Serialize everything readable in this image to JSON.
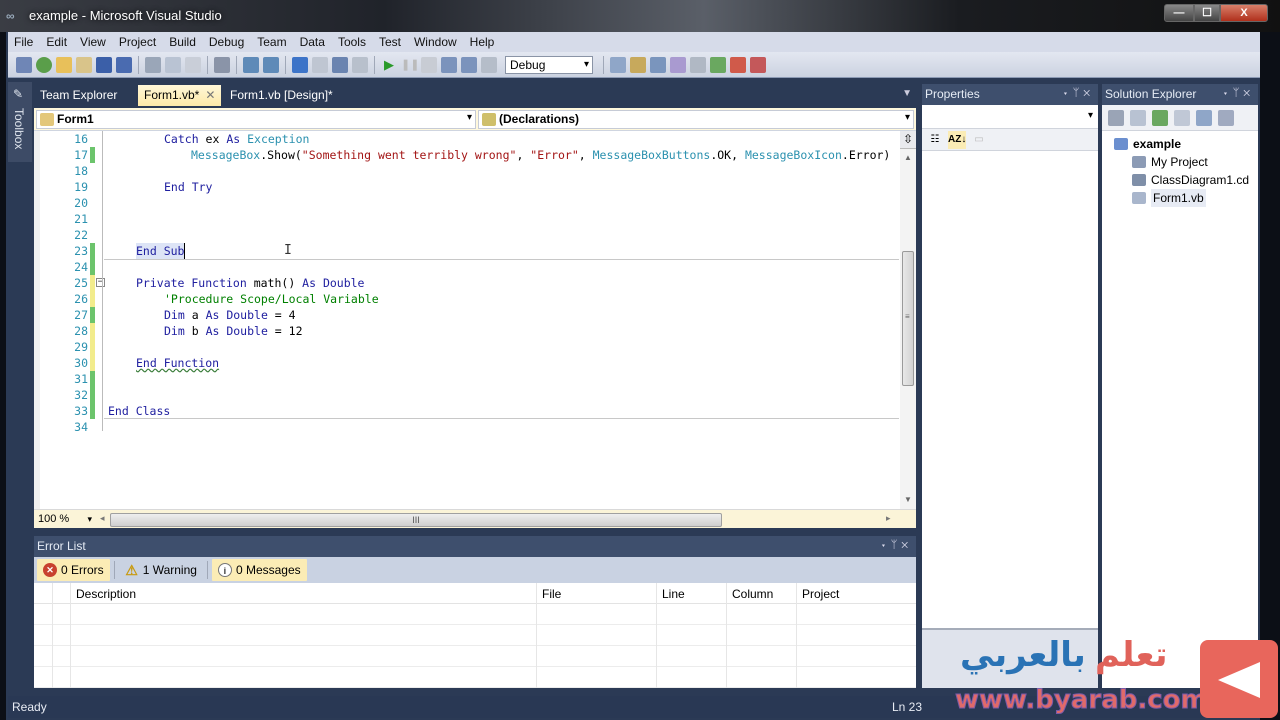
{
  "window": {
    "title": "example - Microsoft Visual Studio",
    "controls": {
      "minimize": "—",
      "maximize": "☐",
      "close": "X"
    }
  },
  "menu": [
    "File",
    "Edit",
    "View",
    "Project",
    "Build",
    "Debug",
    "Team",
    "Data",
    "Tools",
    "Test",
    "Window",
    "Help"
  ],
  "toolbar": {
    "config_value": "Debug",
    "icons": [
      "new-project-icon",
      "add-item-icon",
      "open-file-icon",
      "add-new-item-icon",
      "save-icon",
      "save-all-icon",
      "cut-icon",
      "copy-icon",
      "paste-icon",
      "find-icon",
      "comment-icon",
      "uncomment-icon",
      "undo-icon",
      "redo-icon",
      "navigate-back-icon",
      "navigate-forward-icon",
      "start-debug-icon",
      "pause-icon",
      "stop-icon",
      "step-into-icon",
      "step-over-icon",
      "step-out-icon",
      "solution-explorer-icon",
      "properties-icon",
      "object-browser-icon",
      "toolbox-icon",
      "tools-icon",
      "extension-icon",
      "error-icon",
      "window-icon"
    ]
  },
  "toolbox": {
    "label": "Toolbox"
  },
  "doc_tabs": [
    {
      "label": "Team Explorer",
      "active": false
    },
    {
      "label": "Form1.vb*",
      "active": true
    },
    {
      "label": "Form1.vb [Design]*",
      "active": false
    }
  ],
  "navbar": {
    "class_combo": "Form1",
    "member_combo": "(Declarations)"
  },
  "editor": {
    "lines": [
      {
        "n": "16",
        "change": ""
      },
      {
        "n": "17",
        "change": "green"
      },
      {
        "n": "18",
        "change": ""
      },
      {
        "n": "19",
        "change": ""
      },
      {
        "n": "20",
        "change": ""
      },
      {
        "n": "21",
        "change": ""
      },
      {
        "n": "22",
        "change": ""
      },
      {
        "n": "23",
        "change": "green"
      },
      {
        "n": "24",
        "change": "green"
      },
      {
        "n": "25",
        "change": "yellow"
      },
      {
        "n": "26",
        "change": "yellow"
      },
      {
        "n": "27",
        "change": "green"
      },
      {
        "n": "28",
        "change": "yellow"
      },
      {
        "n": "29",
        "change": "yellow"
      },
      {
        "n": "30",
        "change": "yellow"
      },
      {
        "n": "31",
        "change": "green"
      },
      {
        "n": "32",
        "change": "green"
      },
      {
        "n": "33",
        "change": "green"
      },
      {
        "n": "34",
        "change": ""
      }
    ],
    "code": {
      "l16_kw1": "Catch",
      "l16_id": " ex ",
      "l16_kw2": "As",
      "l16_ty": " Exception",
      "l17_ty1": "MessageBox",
      "l17_call": ".Show(",
      "l17_str1": "\"Something went terribly wrong\"",
      "l17_c1": ", ",
      "l17_str2": "\"Error\"",
      "l17_c2": ", ",
      "l17_ty2": "MessageBoxButtons",
      "l17_v2": ".OK, ",
      "l17_ty3": "MessageBoxIcon",
      "l17_v3": ".Error)",
      "l19_kw": "End Try",
      "l23_kw": "End Sub",
      "l25_kw1": "Private Function",
      "l25_id": " math() ",
      "l25_kw2": "As Double",
      "l26_cm": "'Procedure Scope/Local Variable",
      "l27_kw1": "Dim",
      "l27_id": " a ",
      "l27_kw2": "As Double",
      "l27_v": " = 4",
      "l28_kw1": "Dim",
      "l28_id": " b ",
      "l28_kw2": "As Double",
      "l28_v": " = 12",
      "l30_kw": "End Function",
      "l33_kw": "End Class"
    },
    "zoom_level": "100 %",
    "hscroll_grip": "III",
    "vscroll_grip": "≡"
  },
  "error_list": {
    "title": "Error List",
    "filters": [
      {
        "label": "0 Errors",
        "icon": "error-icon",
        "active": true
      },
      {
        "label": "1 Warning",
        "icon": "warning-icon",
        "active": false
      },
      {
        "label": "0 Messages",
        "icon": "info-icon",
        "active": true
      }
    ],
    "columns": [
      "Description",
      "File",
      "Line",
      "Column",
      "Project"
    ],
    "rows": []
  },
  "properties": {
    "title": "Properties",
    "object_combo": ""
  },
  "solution_explorer": {
    "title": "Solution Explorer",
    "items": [
      {
        "label": "example",
        "icon": "vb-project-icon",
        "bold": true
      },
      {
        "label": "My Project",
        "icon": "my-project-icon"
      },
      {
        "label": "ClassDiagram1.cd",
        "icon": "class-diagram-icon"
      },
      {
        "label": "Form1.vb",
        "icon": "form-icon",
        "selected": true
      }
    ]
  },
  "statusbar": {
    "status": "Ready",
    "line": "Ln 23"
  },
  "watermark": {
    "arabic_blue": "بالعربي",
    "arabic_red": "تعلم",
    "url": "www.byarab.com"
  }
}
